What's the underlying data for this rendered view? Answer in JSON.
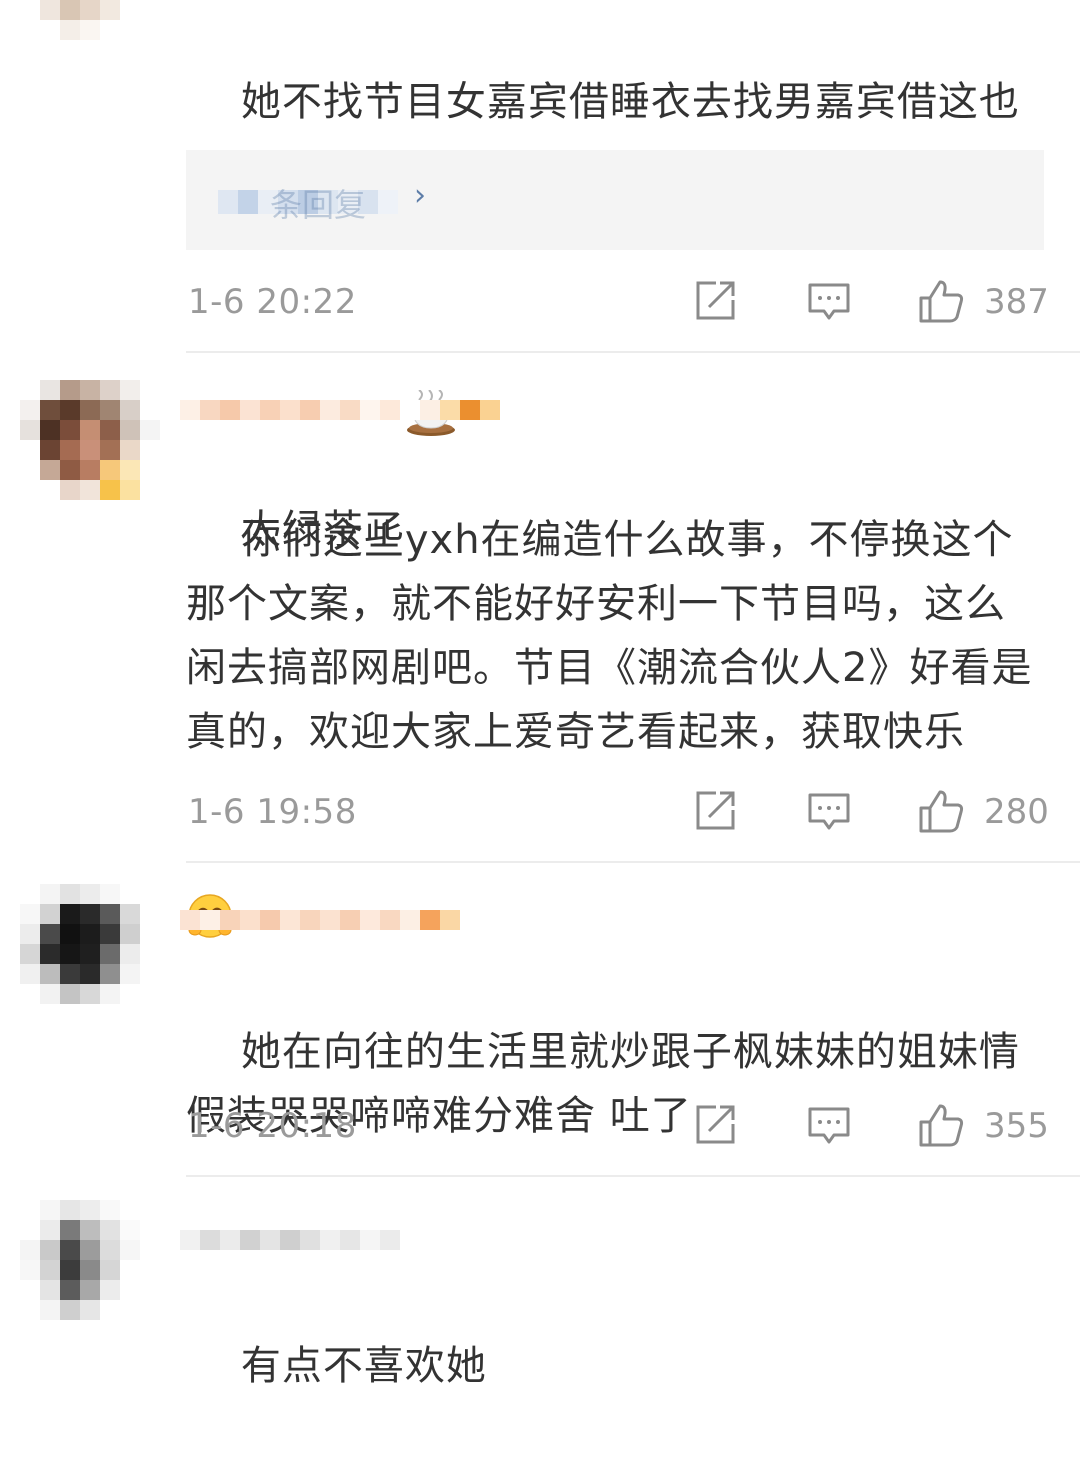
{
  "colors": {
    "text": "#333333",
    "meta": "#9a9a9a",
    "reply_bg": "#f4f4f4",
    "link": "#5d7da8",
    "divider": "#ececec"
  },
  "comments": [
    {
      "text_line1": "她不找节目女嘉宾借睡衣去找男嘉宾借这也",
      "text_line2": "太绿茶了",
      "emoji": "teacup-emoji",
      "reply_text": "条回复",
      "time": "1-6 20:22",
      "likes": "387"
    },
    {
      "text": "你们这些yxh在编造什么故事，不停换这个那个文案，就不能好好安利一下节目吗，这么闲去搞部网剧吧。节目《潮流合伙人2》好看是真的，欢迎大家上爱奇艺看起来，获取快乐",
      "emoji": "blushing-hug-emoji",
      "time": "1-6 19:58",
      "likes": "280"
    },
    {
      "text": "她在向往的生活里就炒跟子枫妹妹的姐妹情假装哭哭啼啼难分难舍 吐了",
      "time": "1-6 20:18",
      "likes": "355"
    },
    {
      "text": "有点不喜欢她"
    }
  ],
  "icons": {
    "share": "share-icon",
    "comment": "comment-icon",
    "like": "thumbs-up-icon"
  }
}
